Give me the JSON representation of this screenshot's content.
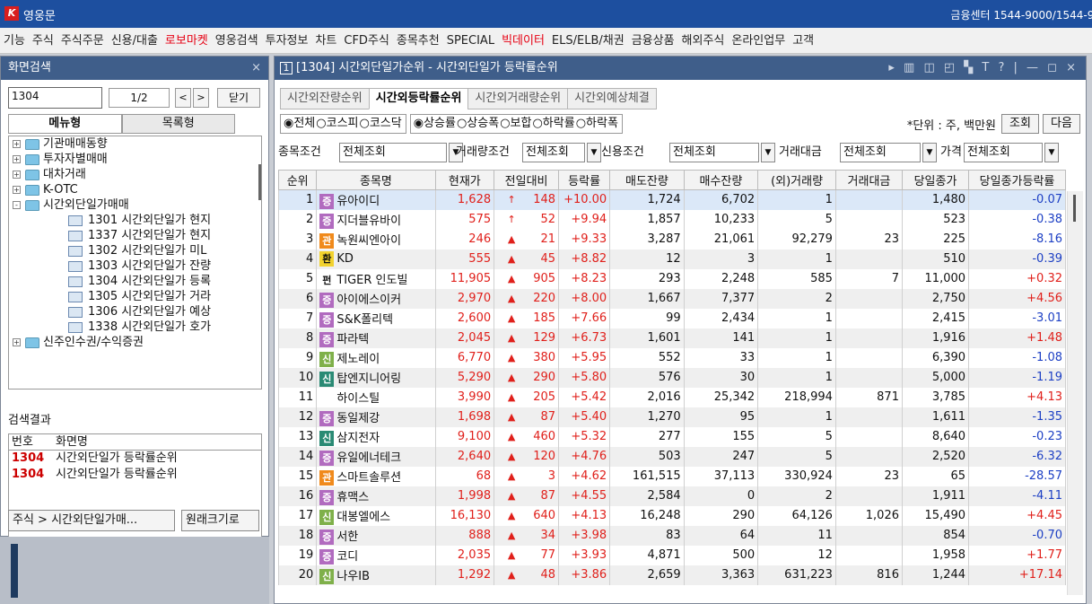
{
  "app": {
    "title": "영웅문",
    "support": "금융센터 1544-9000/1544-99"
  },
  "menu": [
    "기능",
    "주식",
    "주식주문",
    "신용/대출",
    "로보마켓",
    "영웅검색",
    "투자정보",
    "차트",
    "CFD주식",
    "종목추천",
    "SPECIAL",
    "빅데이터",
    "ELS/ELB/채권",
    "금융상품",
    "해외주식",
    "온라인업무",
    "고객"
  ],
  "menu_red": [
    4,
    11
  ],
  "left": {
    "title": "화면검색",
    "close": "×",
    "search_value": "1304",
    "page": "1/2",
    "prev": "<",
    "next": ">",
    "close_btn": "닫기",
    "tab_menu": "메뉴형",
    "tab_list": "목록형",
    "tree": [
      {
        "lvl": 1,
        "pm": "+",
        "label": "기관매매동향"
      },
      {
        "lvl": 1,
        "pm": "+",
        "label": "투자자별매매"
      },
      {
        "lvl": 1,
        "pm": "+",
        "label": "대차거래"
      },
      {
        "lvl": 1,
        "pm": "+",
        "label": "K-OTC"
      },
      {
        "lvl": 1,
        "pm": "-",
        "label": "시간외단일가매매"
      },
      {
        "lvl": 2,
        "label": "1301 시간외단일가 현지"
      },
      {
        "lvl": 2,
        "label": "1337 시간외단일가 현지"
      },
      {
        "lvl": 2,
        "label": "1302 시간외단일가 미L"
      },
      {
        "lvl": 2,
        "label": "1303 시간외단일가 잔량"
      },
      {
        "lvl": 2,
        "label": "1304 시간외단일가 등록"
      },
      {
        "lvl": 2,
        "label": "1305 시간외단일가 거라"
      },
      {
        "lvl": 2,
        "label": "1306 시간외단일가 예상"
      },
      {
        "lvl": 2,
        "label": "1338 시간외단일가 호가"
      },
      {
        "lvl": 1,
        "pm": "+",
        "label": "신주인수권/수익증권"
      }
    ],
    "result_title": "검색결과",
    "result_headers": [
      "번호",
      "화면명"
    ],
    "results": [
      {
        "no": "1304",
        "name": "시간외단일가 등락률순위"
      },
      {
        "no": "1304",
        "name": "시간외단일가 등락률순위"
      }
    ],
    "path": "주식 > 시간외단일가매...",
    "orig": "원래크기로"
  },
  "win": {
    "num": "1",
    "title": "[1304] 시간외단일가순위 - 시간외단일가 등락률순위",
    "controls": "▸ ▥ ◫ ◰ ▚ T ? | — ◻ ×",
    "tabs": [
      "시간외잔량순위",
      "시간외등락률순위",
      "시간외거래량순위",
      "시간외예상체결"
    ],
    "active_tab": 1,
    "market": [
      "◉전체",
      "○코스피",
      "○코스닥"
    ],
    "sort": [
      "◉상승률",
      "○상승폭",
      "○보합",
      "○하락률",
      "○하락폭"
    ],
    "unit": "*단위 : 주, 백만원",
    "btn_query": "조회",
    "btn_next": "다음",
    "filters": [
      {
        "label": "종목조건",
        "value": "전체조회"
      },
      {
        "label": "거래량조건",
        "value": "전체조회"
      },
      {
        "label": "신용조건",
        "value": "전체조회"
      },
      {
        "label": "거래대금",
        "value": "전체조회"
      },
      {
        "label": "가격",
        "value": "전체조회"
      }
    ],
    "headers": [
      "순위",
      "종목명",
      "현재가",
      "전일대비",
      "등락률",
      "매도잔량",
      "매수잔량",
      "(외)거래량",
      "거래대금",
      "당일종가",
      "당일종가등락률"
    ],
    "rows": [
      {
        "rank": "1",
        "badge": "증",
        "bc": "#b16bbf",
        "name": "유아이디",
        "price": "1,628",
        "arr": "↑",
        "chg": "148",
        "rate": "+10.00",
        "ask": "1,724",
        "bid": "6,702",
        "vol": "1",
        "amt": "",
        "close": "1,480",
        "crate": "-0.07",
        "crc": "blue",
        "sel": true
      },
      {
        "rank": "2",
        "badge": "증",
        "bc": "#b16bbf",
        "name": "지더블유바이",
        "price": "575",
        "arr": "↑",
        "chg": "52",
        "rate": "+9.94",
        "ask": "1,857",
        "bid": "10,233",
        "vol": "5",
        "amt": "",
        "close": "523",
        "crate": "-0.38",
        "crc": "blue"
      },
      {
        "rank": "3",
        "badge": "관",
        "bc": "#f08a1c",
        "name": "녹원씨엔아이",
        "price": "246",
        "arr": "▲",
        "chg": "21",
        "rate": "+9.33",
        "ask": "3,287",
        "bid": "21,061",
        "vol": "92,279",
        "amt": "23",
        "close": "225",
        "crate": "-8.16",
        "crc": "blue"
      },
      {
        "rank": "4",
        "badge": "환",
        "bc": "#f2d22e",
        "name": "KD",
        "price": "555",
        "arr": "▲",
        "chg": "45",
        "rate": "+8.82",
        "ask": "12",
        "bid": "3",
        "vol": "1",
        "amt": "",
        "close": "510",
        "crate": "-0.39",
        "crc": "blue",
        "grey": true
      },
      {
        "rank": "5",
        "badge": "펀",
        "bc": "",
        "name": "TIGER 인도빌",
        "price": "11,905",
        "arr": "▲",
        "chg": "905",
        "rate": "+8.23",
        "ask": "293",
        "bid": "2,248",
        "vol": "585",
        "amt": "7",
        "close": "11,000",
        "crate": "+0.32",
        "crc": "red"
      },
      {
        "rank": "6",
        "badge": "증",
        "bc": "#b16bbf",
        "name": "아이에스이커",
        "price": "2,970",
        "arr": "▲",
        "chg": "220",
        "rate": "+8.00",
        "ask": "1,667",
        "bid": "7,377",
        "vol": "2",
        "amt": "",
        "close": "2,750",
        "crate": "+4.56",
        "crc": "red",
        "grey": true
      },
      {
        "rank": "7",
        "badge": "증",
        "bc": "#b16bbf",
        "name": "S&K폴리텍",
        "price": "2,600",
        "arr": "▲",
        "chg": "185",
        "rate": "+7.66",
        "ask": "99",
        "bid": "2,434",
        "vol": "1",
        "amt": "",
        "close": "2,415",
        "crate": "-3.01",
        "crc": "blue"
      },
      {
        "rank": "8",
        "badge": "증",
        "bc": "#b16bbf",
        "name": "파라텍",
        "price": "2,045",
        "arr": "▲",
        "chg": "129",
        "rate": "+6.73",
        "ask": "1,601",
        "bid": "141",
        "vol": "1",
        "amt": "",
        "close": "1,916",
        "crate": "+1.48",
        "crc": "red",
        "grey": true
      },
      {
        "rank": "9",
        "badge": "신",
        "bc": "#7fb04a",
        "name": "제노레이",
        "price": "6,770",
        "arr": "▲",
        "chg": "380",
        "rate": "+5.95",
        "ask": "552",
        "bid": "33",
        "vol": "1",
        "amt": "",
        "close": "6,390",
        "crate": "-1.08",
        "crc": "blue"
      },
      {
        "rank": "10",
        "badge": "신",
        "bc": "#2a8a74",
        "name": "탑엔지니어링",
        "price": "5,290",
        "arr": "▲",
        "chg": "290",
        "rate": "+5.80",
        "ask": "576",
        "bid": "30",
        "vol": "1",
        "amt": "",
        "close": "5,000",
        "crate": "-1.19",
        "crc": "blue",
        "grey": true
      },
      {
        "rank": "11",
        "badge": "",
        "bc": "",
        "name": "하이스틸",
        "price": "3,990",
        "arr": "▲",
        "chg": "205",
        "rate": "+5.42",
        "ask": "2,016",
        "bid": "25,342",
        "vol": "218,994",
        "amt": "871",
        "close": "3,785",
        "crate": "+4.13",
        "crc": "red"
      },
      {
        "rank": "12",
        "badge": "증",
        "bc": "#b16bbf",
        "name": "동일제강",
        "price": "1,698",
        "arr": "▲",
        "chg": "87",
        "rate": "+5.40",
        "ask": "1,270",
        "bid": "95",
        "vol": "1",
        "amt": "",
        "close": "1,611",
        "crate": "-1.35",
        "crc": "blue",
        "grey": true
      },
      {
        "rank": "13",
        "badge": "신",
        "bc": "#2a8a74",
        "name": "삼지전자",
        "price": "9,100",
        "arr": "▲",
        "chg": "460",
        "rate": "+5.32",
        "ask": "277",
        "bid": "155",
        "vol": "5",
        "amt": "",
        "close": "8,640",
        "crate": "-0.23",
        "crc": "blue"
      },
      {
        "rank": "14",
        "badge": "증",
        "bc": "#b16bbf",
        "name": "유일에너테크",
        "price": "2,640",
        "arr": "▲",
        "chg": "120",
        "rate": "+4.76",
        "ask": "503",
        "bid": "247",
        "vol": "5",
        "amt": "",
        "close": "2,520",
        "crate": "-6.32",
        "crc": "blue",
        "grey": true
      },
      {
        "rank": "15",
        "badge": "관",
        "bc": "#f08a1c",
        "name": "스마트솔루션",
        "price": "68",
        "arr": "▲",
        "chg": "3",
        "rate": "+4.62",
        "ask": "161,515",
        "bid": "37,113",
        "vol": "330,924",
        "amt": "23",
        "close": "65",
        "crate": "-28.57",
        "crc": "blue"
      },
      {
        "rank": "16",
        "badge": "증",
        "bc": "#b16bbf",
        "name": "휴맥스",
        "price": "1,998",
        "arr": "▲",
        "chg": "87",
        "rate": "+4.55",
        "ask": "2,584",
        "bid": "0",
        "vol": "2",
        "amt": "",
        "close": "1,911",
        "crate": "-4.11",
        "crc": "blue",
        "grey": true
      },
      {
        "rank": "17",
        "badge": "신",
        "bc": "#7fb04a",
        "name": "대봉엘에스",
        "price": "16,130",
        "arr": "▲",
        "chg": "640",
        "rate": "+4.13",
        "ask": "16,248",
        "bid": "290",
        "vol": "64,126",
        "amt": "1,026",
        "close": "15,490",
        "crate": "+4.45",
        "crc": "red"
      },
      {
        "rank": "18",
        "badge": "증",
        "bc": "#b16bbf",
        "name": "서한",
        "price": "888",
        "arr": "▲",
        "chg": "34",
        "rate": "+3.98",
        "ask": "83",
        "bid": "64",
        "vol": "11",
        "amt": "",
        "close": "854",
        "crate": "-0.70",
        "crc": "blue",
        "grey": true
      },
      {
        "rank": "19",
        "badge": "증",
        "bc": "#b16bbf",
        "name": "코디",
        "price": "2,035",
        "arr": "▲",
        "chg": "77",
        "rate": "+3.93",
        "ask": "4,871",
        "bid": "500",
        "vol": "12",
        "amt": "",
        "close": "1,958",
        "crate": "+1.77",
        "crc": "red"
      },
      {
        "rank": "20",
        "badge": "신",
        "bc": "#7fb04a",
        "name": "나우IB",
        "price": "1,292",
        "arr": "▲",
        "chg": "48",
        "rate": "+3.86",
        "ask": "2,659",
        "bid": "3,363",
        "vol": "631,223",
        "amt": "816",
        "close": "1,244",
        "crate": "+17.14",
        "crc": "red",
        "grey": true
      }
    ]
  }
}
